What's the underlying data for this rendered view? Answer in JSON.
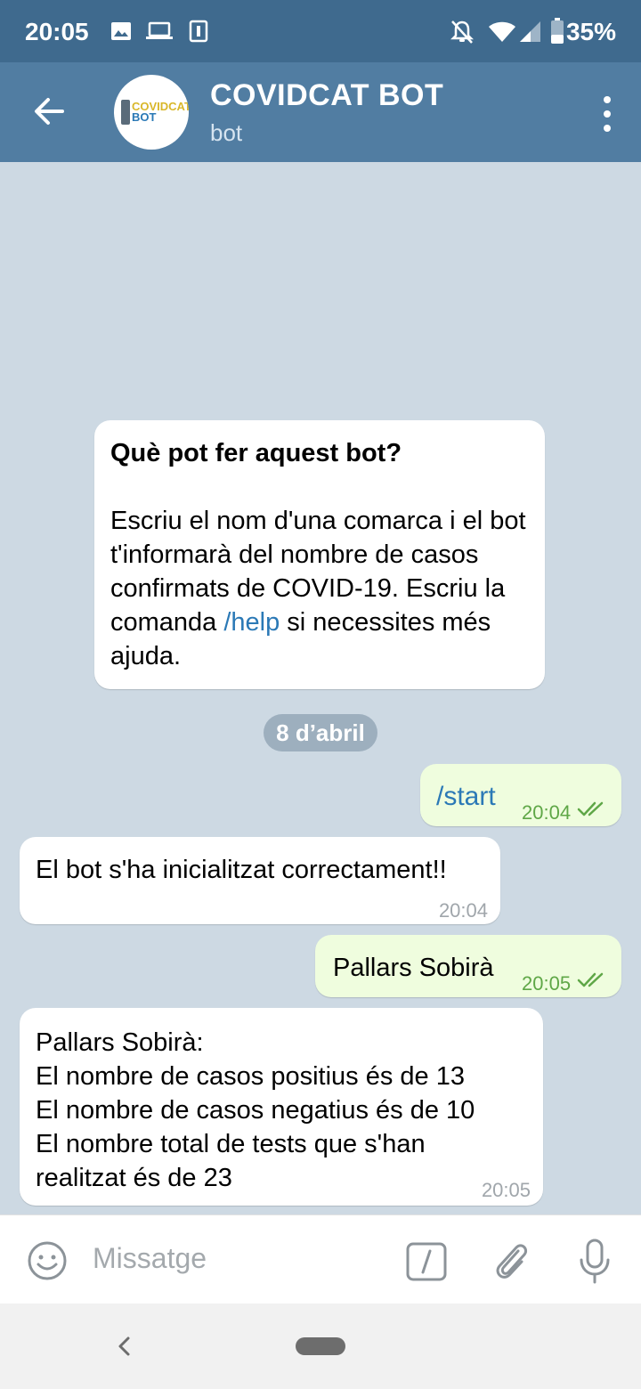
{
  "status_bar": {
    "time": "20:05",
    "battery": "35%",
    "icons": [
      "image-icon",
      "laptop-icon",
      "sim-icon",
      "notifications-off-icon",
      "wifi-icon",
      "signal-icon",
      "battery-icon"
    ]
  },
  "header": {
    "title": "COVIDCAT BOT",
    "subtitle": "bot",
    "avatar_text_line1": "COVIDCAT",
    "avatar_text_line2": "BOT"
  },
  "info_card": {
    "title": "Què pot fer aquest bot?",
    "body_part1": "Escriu el nom d'una comarca i el bot t'informarà del nombre de casos confirmats de COVID-19. Escriu la comanda ",
    "command": "/help",
    "body_part2": " si necessites més ajuda."
  },
  "date_separator": "8 d’abril",
  "messages": [
    {
      "direction": "out",
      "text": "/start",
      "time": "20:04",
      "read": true
    },
    {
      "direction": "in",
      "text": "El bot s'ha inicialitzat correctament!!",
      "time": "20:04"
    },
    {
      "direction": "out",
      "text": "Pallars Sobirà",
      "time": "20:05",
      "read": true
    },
    {
      "direction": "in",
      "lines": [
        "Pallars Sobirà:",
        "El nombre de casos positius és de 13",
        "El nombre de casos negatius és de 10",
        "El nombre total de tests que s'han",
        "realitzat és de 23"
      ],
      "time": "20:05"
    }
  ],
  "input": {
    "placeholder": "Missatge"
  },
  "colors": {
    "status_bar": "#3f6a8e",
    "app_bar": "#517da2",
    "chat_bg": "#cdd9e3",
    "outgoing_bubble": "#effdde",
    "incoming_bubble": "#ffffff",
    "link": "#2b79b6",
    "check_green": "#5fa747"
  }
}
